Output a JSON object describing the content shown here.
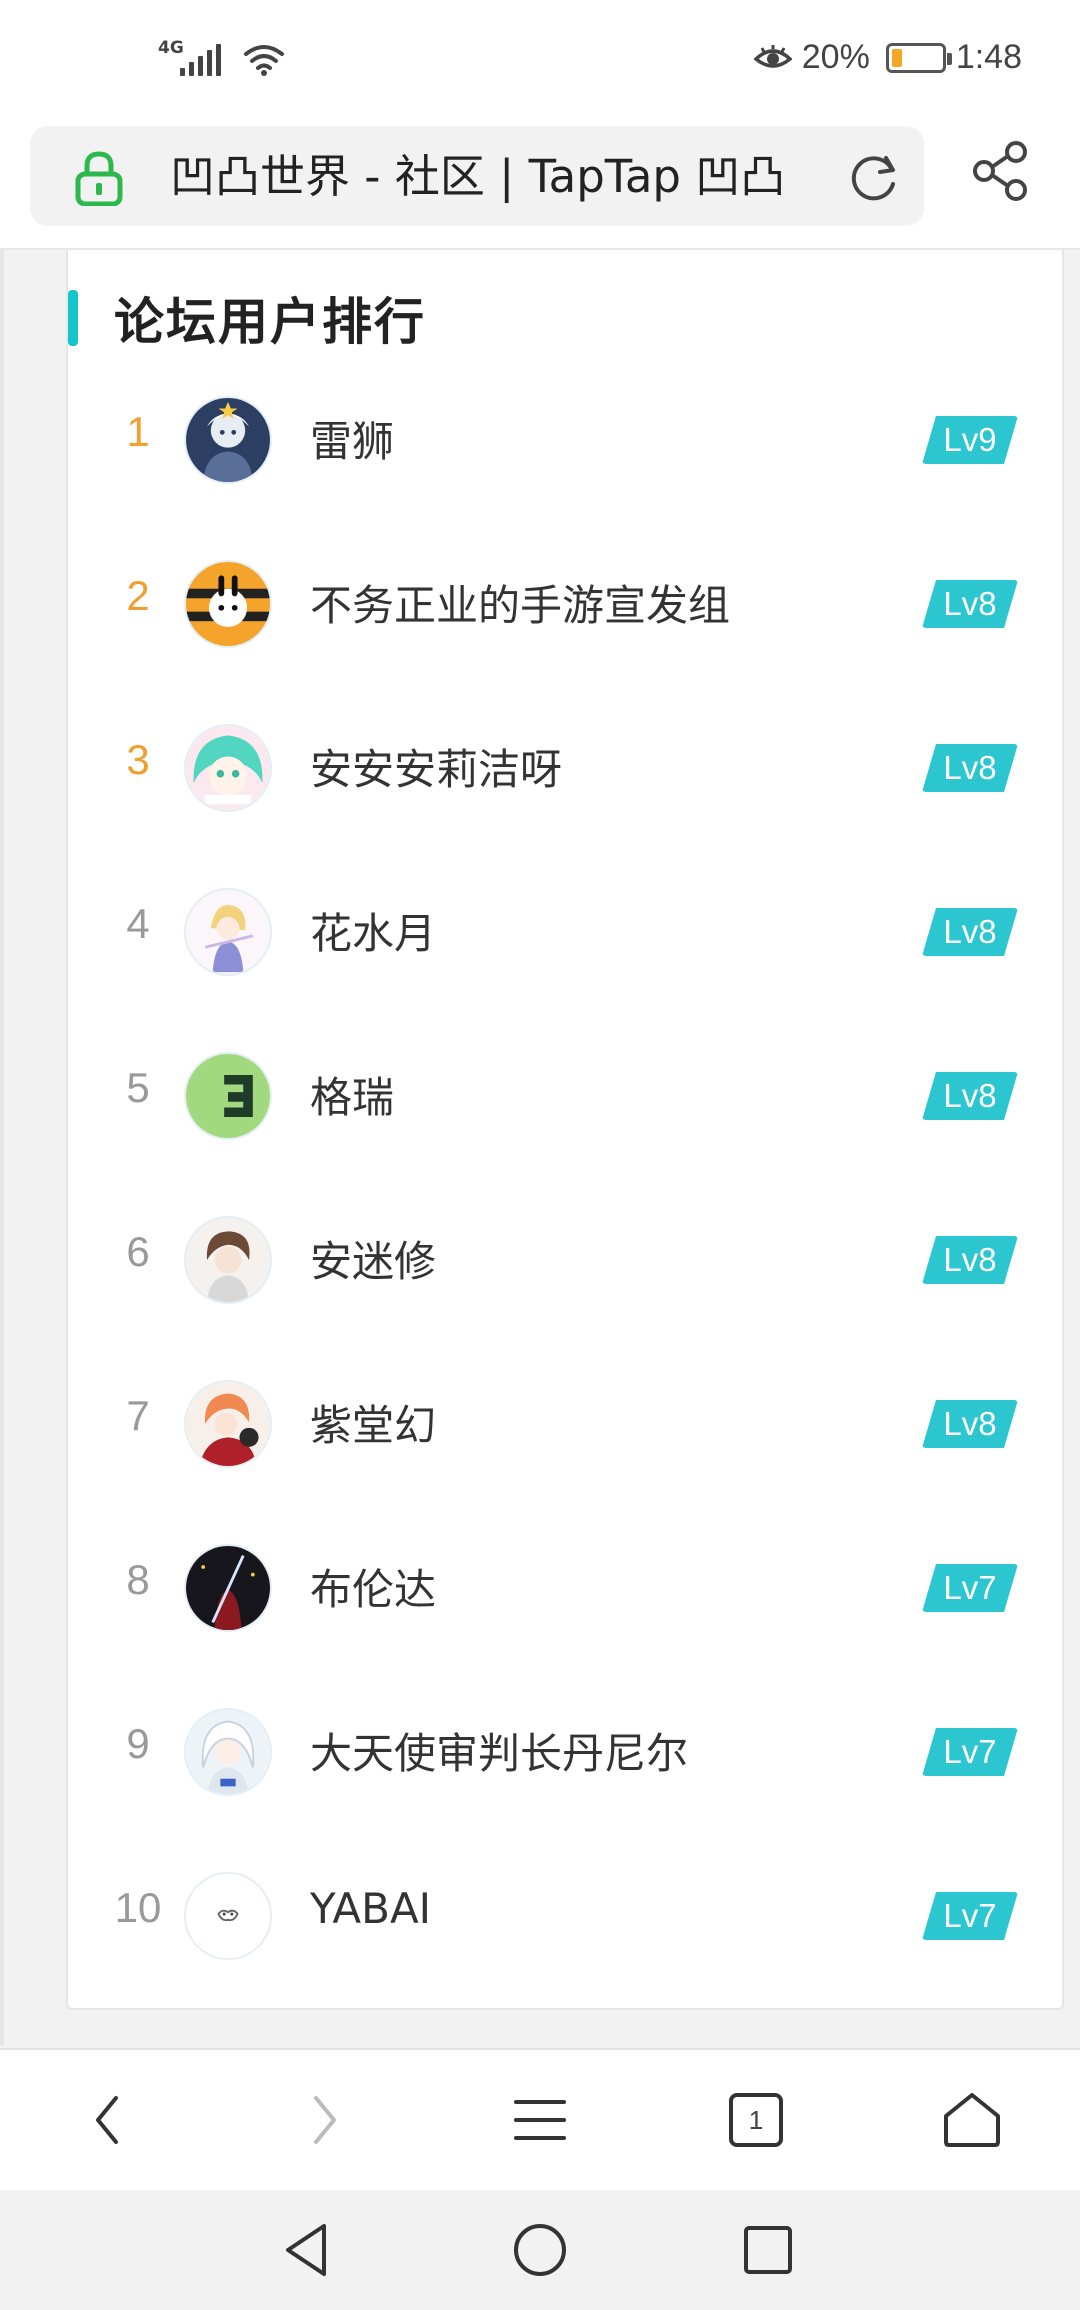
{
  "status_bar": {
    "network": "4G",
    "battery_percent": "20%",
    "time": "1:48",
    "battery_level": 0.2,
    "icons": [
      "signal-icon",
      "wifi-icon",
      "eye-comfort-icon",
      "battery-icon"
    ]
  },
  "browser": {
    "page_title": "凹凸世界 - 社区 | TapTap 凹凸",
    "icons": [
      "lock-icon",
      "reload-icon",
      "share-icon"
    ]
  },
  "section": {
    "title": "论坛用户排行"
  },
  "ranking": [
    {
      "rank": "1",
      "name": "雷狮",
      "level": "Lv9"
    },
    {
      "rank": "2",
      "name": "不务正业的手游宣发组",
      "level": "Lv8"
    },
    {
      "rank": "3",
      "name": "安安安莉洁呀",
      "level": "Lv8"
    },
    {
      "rank": "4",
      "name": "花水月",
      "level": "Lv8"
    },
    {
      "rank": "5",
      "name": "格瑞",
      "level": "Lv8"
    },
    {
      "rank": "6",
      "name": "安迷修",
      "level": "Lv8"
    },
    {
      "rank": "7",
      "name": "紫堂幻",
      "level": "Lv8"
    },
    {
      "rank": "8",
      "name": "布伦达",
      "level": "Lv7"
    },
    {
      "rank": "9",
      "name": "大天使审判长丹尼尔",
      "level": "Lv7"
    },
    {
      "rank": "10",
      "name": "YABAI",
      "level": "Lv7"
    }
  ],
  "toolbar": {
    "tab_count": "1",
    "icons": [
      "back-icon",
      "forward-icon",
      "menu-icon",
      "tabs-icon",
      "home-icon"
    ]
  },
  "system_nav": {
    "icons": [
      "nav-back-icon",
      "nav-home-icon",
      "nav-recent-icon"
    ]
  },
  "colors": {
    "accent": "#15c5ce",
    "level_badge": "#2cc6d0",
    "top_rank": "#f0a030",
    "lock": "#2db84d",
    "battery_fill": "#f5a623"
  }
}
